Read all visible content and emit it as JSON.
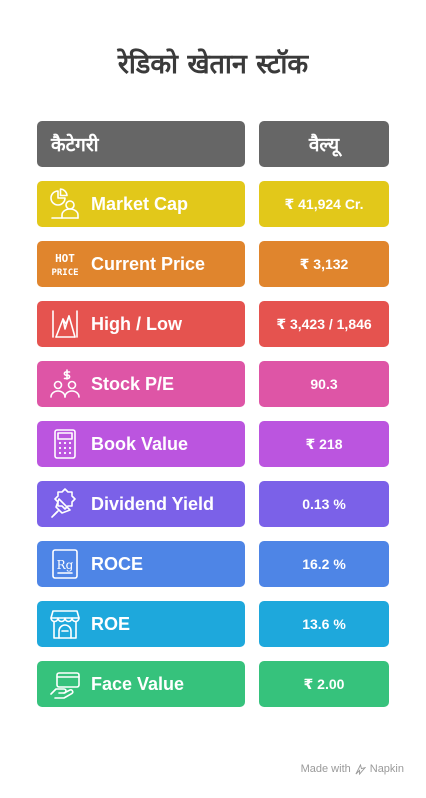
{
  "title": "रेडिको खेतान स्टॉक",
  "header": {
    "left": "कैटेगरी",
    "right": "वैल्यू"
  },
  "rows": [
    {
      "label": "Market Cap",
      "value": "₹ 41,924 Cr.",
      "color": "#E2C81A",
      "icon": "pie-chart-person-icon"
    },
    {
      "label": "Current Price",
      "value": "₹ 3,132",
      "color": "#E0852D",
      "icon": "hot-price-icon",
      "icon_text_1": "HOT",
      "icon_text_2": "PRICE"
    },
    {
      "label": "High / Low",
      "value": "₹ 3,423 / 1,846",
      "color": "#E5534F",
      "icon": "mountain-peaks-icon"
    },
    {
      "label": "Stock P/E",
      "value": "90.3",
      "color": "#DE55A6",
      "icon": "people-money-icon"
    },
    {
      "label": "Book Value",
      "value": "₹ 218",
      "color": "#BB55DF",
      "icon": "calculator-icon"
    },
    {
      "label": "Dividend Yield",
      "value": "0.13 %",
      "color": "#7B61E8",
      "icon": "megaphone-badge-icon"
    },
    {
      "label": "ROCE",
      "value": "16.2 %",
      "color": "#4E85E6",
      "icon": "rg-document-icon",
      "icon_text_1": "Rg"
    },
    {
      "label": "ROE",
      "value": "13.6 %",
      "color": "#1EA8DC",
      "icon": "storefront-icon"
    },
    {
      "label": "Face Value",
      "value": "₹ 2.00",
      "color": "#36C27C",
      "icon": "hand-card-icon"
    }
  ],
  "footer": {
    "text": "Made with",
    "brand": "Napkin"
  }
}
